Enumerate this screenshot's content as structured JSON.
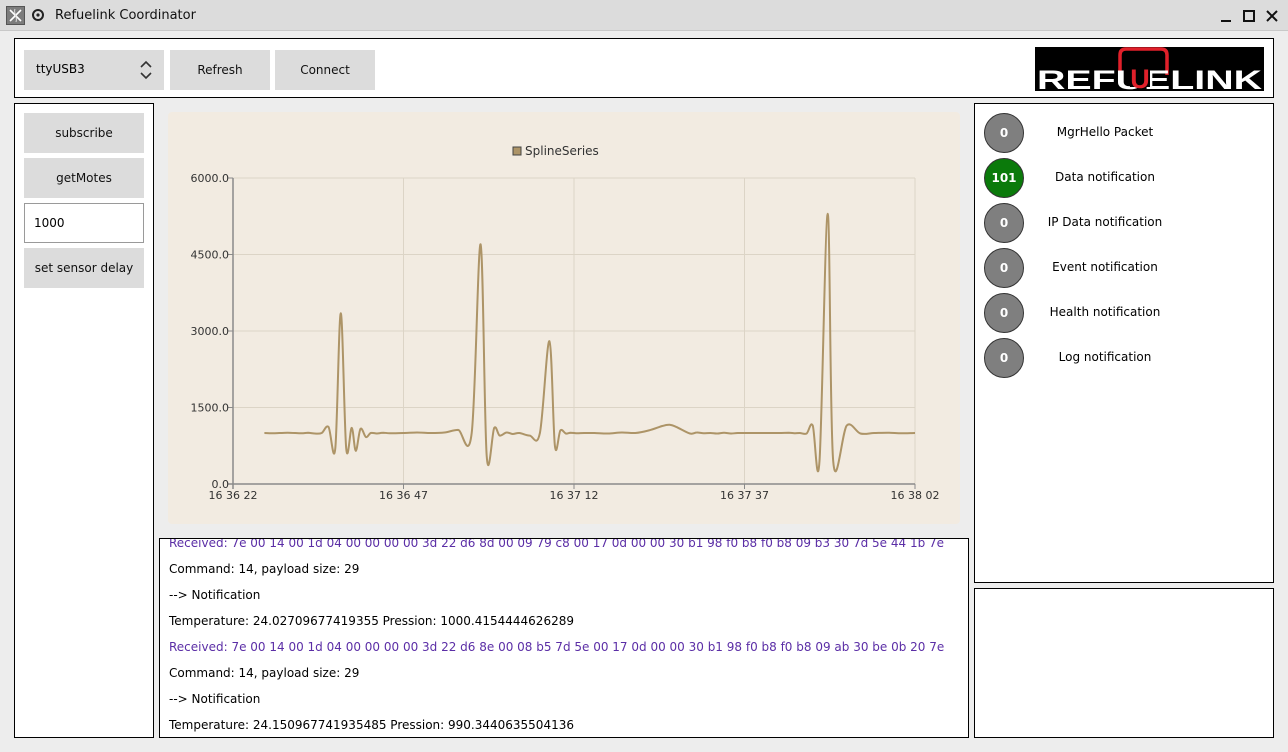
{
  "window": {
    "title": "Refuelink Coordinator"
  },
  "toolbar": {
    "port_value": "ttyUSB3",
    "refresh_label": "Refresh",
    "connect_label": "Connect",
    "logo_text": "REFUELINK"
  },
  "sidebar": {
    "subscribe_label": "subscribe",
    "getmotes_label": "getMotes",
    "delay_value": "1000",
    "set_delay_label": "set sensor delay"
  },
  "chart_data": {
    "type": "line",
    "legend": [
      "SplineSeries"
    ],
    "legend_position": "top",
    "series_color": "#ad9467",
    "background": "#f2ebe1",
    "grid": true,
    "ylim": [
      0,
      6000
    ],
    "yticks": [
      "0.0",
      "1500.0",
      "3000.0",
      "4500.0",
      "6000.0"
    ],
    "xticks": [
      "16 36 22",
      "16 36 47",
      "16 37 12",
      "16 37 37",
      "16 38 02"
    ],
    "xlim_seconds": [
      0,
      100
    ],
    "series": [
      {
        "name": "SplineSeries",
        "x": [
          4.6,
          6,
          8,
          10,
          11,
          12,
          13,
          14,
          15,
          15.8,
          16.6,
          17.4,
          18.0,
          18.7,
          19.5,
          20.2,
          21.1,
          22.0,
          23.0,
          25,
          27,
          29,
          31,
          33,
          35,
          36.3,
          37.2,
          38.3,
          39.1,
          40.1,
          41.0,
          42,
          43.5,
          45,
          46.4,
          47.2,
          48.0,
          48.8,
          49.5,
          50.5,
          51.5,
          53,
          55,
          57,
          59,
          61,
          63,
          64,
          65,
          67,
          68,
          69,
          70,
          71,
          72,
          73,
          74,
          76,
          78,
          80,
          81.5,
          82.3,
          83.1,
          84.1,
          85.0,
          86,
          87.2,
          88,
          90,
          92,
          94,
          96,
          98,
          100
        ],
        "y": [
          1000,
          995,
          1005,
          995,
          1005,
          990,
          1000,
          1120,
          700,
          3350,
          700,
          1100,
          650,
          1080,
          920,
          1000,
          990,
          1005,
          995,
          1000,
          1010,
          1000,
          1010,
          1060,
          1000,
          4700,
          550,
          1100,
          950,
          1010,
          980,
          1000,
          950,
          1000,
          2800,
          750,
          1050,
          990,
          1005,
          995,
          1000,
          1000,
          990,
          1010,
          1000,
          1050,
          1140,
          1160,
          1120,
          990,
          1010,
          995,
          1000,
          990,
          1005,
          990,
          1000,
          1000,
          1000,
          1000,
          1005,
          995,
          1000,
          990,
          1150,
          450,
          5300,
          450,
          1150,
          990,
          1000,
          1005,
          995,
          1000
        ]
      }
    ]
  },
  "log": {
    "lines": [
      {
        "kind": "recv",
        "text": "Received: 7e 00 14 00 1d 04 00 00 00 00 3d 22 d6 8d 00 09 79 c8 00 17 0d 00 00 30 b1 98 f0 b8 f0 b8 09 b3 30 7d 5e 44 1b 7e"
      },
      {
        "kind": "info",
        "text": "Command: 14, payload size: 29"
      },
      {
        "kind": "info",
        "text": "--> Notification"
      },
      {
        "kind": "info",
        "text": "Temperature: 24.02709677419355 Pression: 1000.4154444626289"
      },
      {
        "kind": "recv",
        "text": "Received: 7e 00 14 00 1d 04 00 00 00 00 3d 22 d6 8e 00 08 b5 7d 5e 00 17 0d 00 00 30 b1 98 f0 b8 f0 b8 09 ab 30 be 0b 20 7e"
      },
      {
        "kind": "info",
        "text": "Command: 14, payload size: 29"
      },
      {
        "kind": "info",
        "text": "--> Notification"
      },
      {
        "kind": "info",
        "text": "Temperature: 24.150967741935485 Pression: 990.3440635504136"
      }
    ]
  },
  "notifications": {
    "inactive_color": "#7f7f7f",
    "active_color": "#0b7a0b",
    "items": [
      {
        "count": "0",
        "label": "MgrHello Packet",
        "active": false
      },
      {
        "count": "101",
        "label": "Data notification",
        "active": true
      },
      {
        "count": "0",
        "label": "IP Data notification",
        "active": false
      },
      {
        "count": "0",
        "label": "Event notification",
        "active": false
      },
      {
        "count": "0",
        "label": "Health notification",
        "active": false
      },
      {
        "count": "0",
        "label": "Log notification",
        "active": false
      }
    ]
  }
}
